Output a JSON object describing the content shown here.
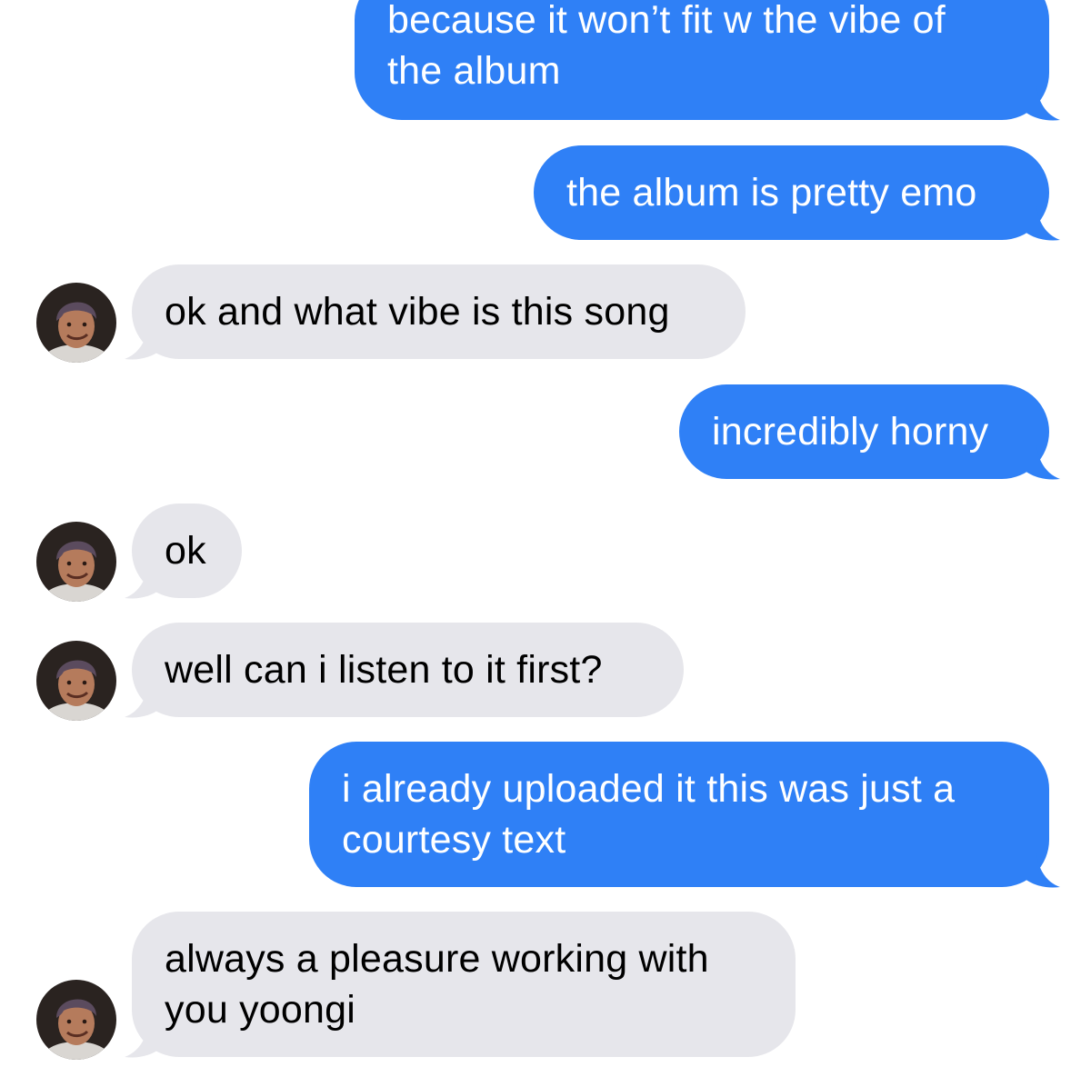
{
  "conversation": {
    "messages": [
      {
        "direction": "sent",
        "lines": [
          "because it won’t fit w the vibe of",
          "the album"
        ]
      },
      {
        "direction": "sent",
        "lines": [
          "the album is pretty emo"
        ]
      },
      {
        "direction": "received",
        "lines": [
          "ok and what vibe is this song"
        ]
      },
      {
        "direction": "sent",
        "lines": [
          "incredibly horny"
        ]
      },
      {
        "direction": "received",
        "lines": [
          "ok"
        ]
      },
      {
        "direction": "received",
        "lines": [
          "well can i listen to it first?"
        ]
      },
      {
        "direction": "sent",
        "lines": [
          "i already uploaded it this was just a",
          "courtesy text"
        ]
      },
      {
        "direction": "received",
        "lines": [
          "always a pleasure working with",
          "you yoongi"
        ]
      }
    ]
  },
  "colors": {
    "sent_bubble": "#2f80f6",
    "received_bubble": "#e6e6eb",
    "background": "#ffffff"
  },
  "icons": {
    "contact_avatar": "contact-avatar-photo"
  }
}
